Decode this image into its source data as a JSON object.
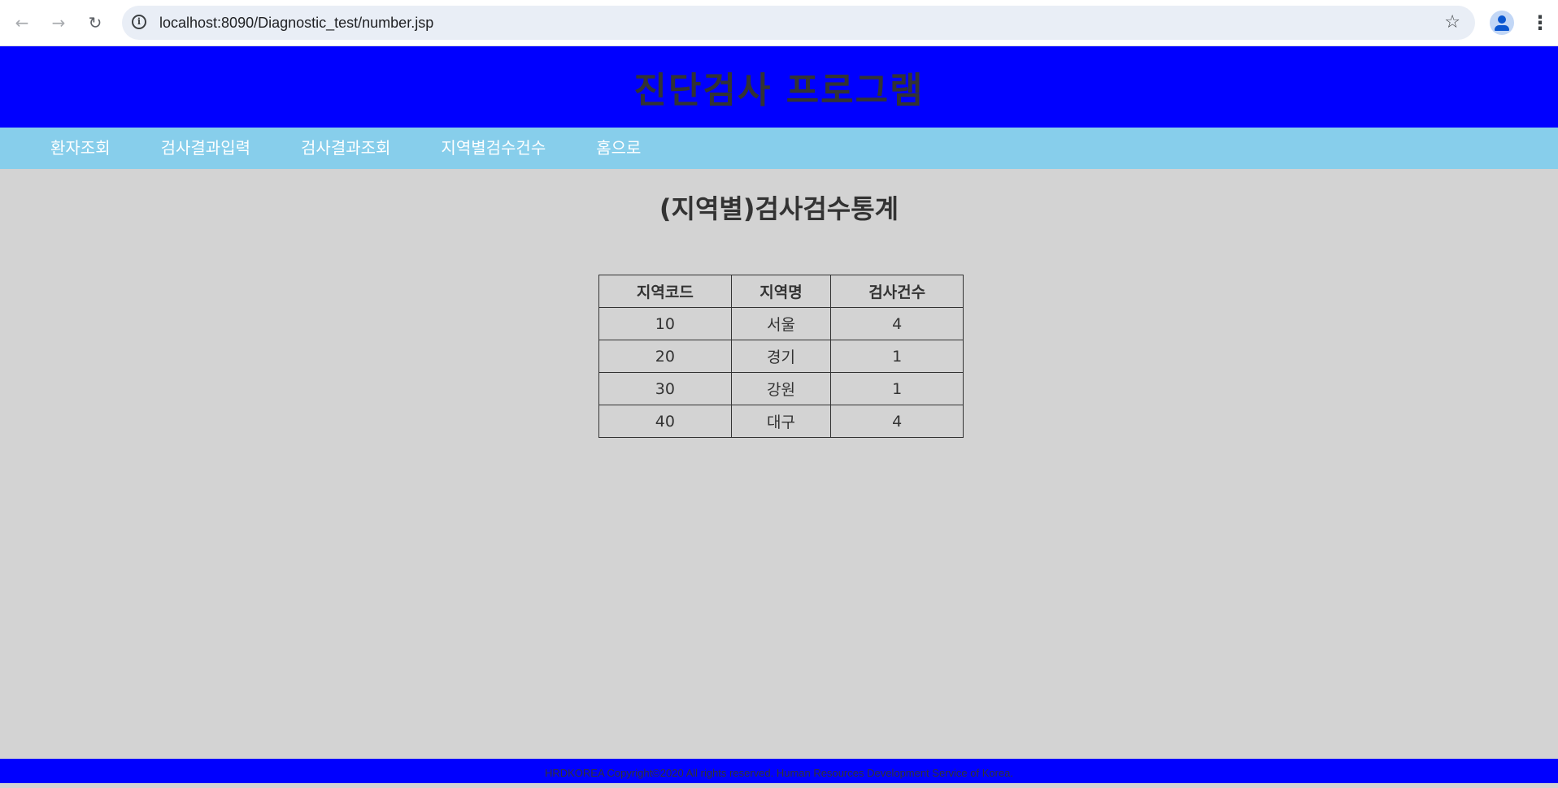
{
  "browser": {
    "url": "localhost:8090/Diagnostic_test/number.jsp",
    "back_icon": "←",
    "forward_icon": "→",
    "reload_icon": "↻",
    "star_icon": "☆",
    "info_icon": "i",
    "menu_icon": "⋮"
  },
  "header": {
    "title": "진단검사 프로그램"
  },
  "nav": {
    "items": [
      {
        "label": "환자조회"
      },
      {
        "label": "검사결과입력"
      },
      {
        "label": "검사결과조회"
      },
      {
        "label": "지역별검수건수"
      },
      {
        "label": "홈으로"
      }
    ]
  },
  "main": {
    "title": "(지역별)검사검수통계",
    "table": {
      "headers": [
        "지역코드",
        "지역명",
        "검사건수"
      ],
      "rows": [
        [
          "10",
          "서울",
          "4"
        ],
        [
          "20",
          "경기",
          "1"
        ],
        [
          "30",
          "강원",
          "1"
        ],
        [
          "40",
          "대구",
          "4"
        ]
      ]
    }
  },
  "footer": {
    "text": "HRDKOREA Copyright©2020 All rights reserved. Human Resources Development Service of Korea."
  },
  "colors": {
    "header_bg": "#0000ff",
    "nav_bg": "#87ceeb",
    "page_bg": "#d3d3d3"
  }
}
